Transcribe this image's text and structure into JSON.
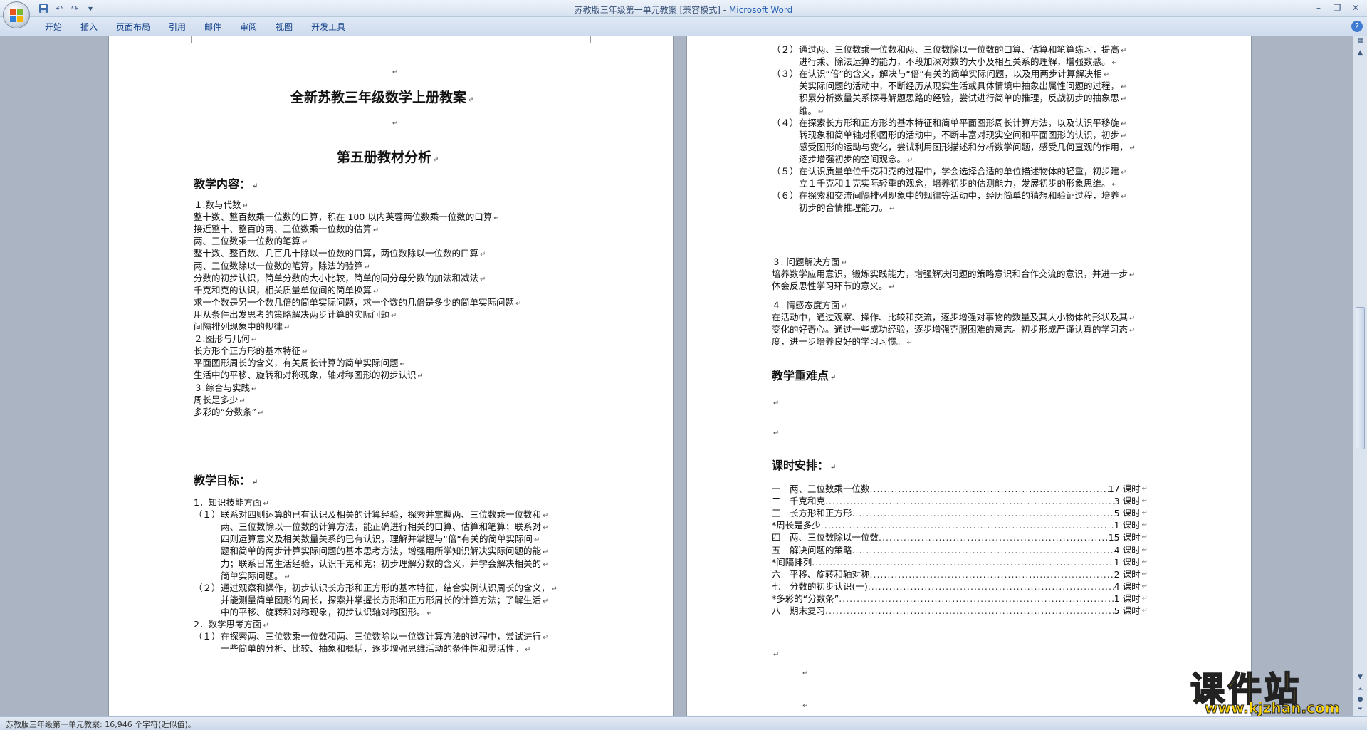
{
  "window": {
    "title": "苏教版三年级第一单元教案 [兼容模式] - ",
    "app_name": "Microsoft Word"
  },
  "tabs": [
    "开始",
    "插入",
    "页面布局",
    "引用",
    "邮件",
    "审阅",
    "视图",
    "开发工具"
  ],
  "status": {
    "text": "苏教版三年级第一单元教案: 16,946 个字符(近似值)。"
  },
  "watermark": {
    "title": "课件站",
    "url": "www.kjzhan.com"
  },
  "page1": {
    "doc_title": "全新苏教三年级数学上册教案",
    "subtitle": "第五册教材分析",
    "content_heading": "教学内容：",
    "content_lines": [
      "１.数与代数",
      "整十数、整百数乘一位数的口算，积在 100 以内芙蓉两位数乘一位数的口算",
      "接近整十、整百的两、三位数乘一位数的估算",
      "两、三位数乘一位数的笔算",
      "整十数、整百数、几百几十除以一位数的口算，两位数除以一位数的口算",
      "两、三位数除以一位数的笔算，除法的验算",
      "分数的初步认识，简单分数的大小比较，简单的同分母分数的加法和减法",
      "千克和克的认识，相关质量单位间的简单换算",
      "求一个数是另一个数几倍的简单实际问题，求一个数的几倍是多少的简单实际问题",
      "用从条件出发思考的策略解决两步计算的实际问题",
      "间隔排列现象中的规律",
      "２.图形与几何",
      "长方形个正方形的基本特征",
      "平面图形周长的含义，有关周长计算的简单实际问题",
      "生活中的平移、旋转和对称现象，轴对称图形的初步认识",
      "３.综合与实践",
      "周长是多少",
      "多彩的“分数条”"
    ],
    "goals_heading": "教学目标：",
    "goal_lines": [
      {
        "num": "",
        "text": "1．知识技能方面"
      },
      {
        "num": "（１）",
        "text": "联系对四则运算的已有认识及相关的计算经验，探索并掌握两、三位数乘一位数和"
      },
      {
        "num": "",
        "text": "两、三位数除以一位数的计算方法，能正确进行相关的口算、估算和笔算；联系对"
      },
      {
        "num": "",
        "text": "四则运算意义及相关数量关系的已有认识，理解并掌握与“倍“有关的简单实际问"
      },
      {
        "num": "",
        "text": "题和简单的两步计算实际问题的基本思考方法，增强用所学知识解决实际问题的能"
      },
      {
        "num": "",
        "text": "力；联系日常生活经验，认识千克和克；初步理解分数的含义，并学会解决相关的"
      },
      {
        "num": "",
        "text": "简单实际问题。"
      },
      {
        "num": "（２）",
        "text": "通过观察和操作，初步认识长方形和正方形的基本特征，结合实例认识周长的含义，"
      },
      {
        "num": "",
        "text": "并能测量简单图形的周长，探索并掌握长方形和正方形周长的计算方法；了解生活"
      },
      {
        "num": "",
        "text": "中的平移、旋转和对称现象，初步认识轴对称图形。"
      },
      {
        "num": "",
        "text": "2．数学思考方面"
      },
      {
        "num": "（１）",
        "text": "在探索两、三位数乘一位数和两、三位数除以一位数计算方法的过程中，尝试进行"
      },
      {
        "num": "",
        "text": "一些简单的分析、比较、抽象和概括，逐步增强思维活动的条件性和灵活性。"
      }
    ]
  },
  "page2": {
    "lines": [
      {
        "num": "（２）",
        "text": "通过两、三位数乘一位数和两、三位数除以一位数的口算、估算和笔算练习，提高"
      },
      {
        "num": "",
        "text": "进行乘、除法运算的能力，不段加深对数的大小及相互关系的理解，增强数感。"
      },
      {
        "num": "（３）",
        "text": "在认识“倍”的含义，解决与“倍”有关的简单实际问题，以及用两步计算解决相"
      },
      {
        "num": "",
        "text": "关实际问题的活动中，不断经历从现实生活或具体情境中抽象出属性问题的过程，"
      },
      {
        "num": "",
        "text": "积累分析数量关系探寻解题思路的经验，尝试进行简单的推理，反战初步的抽象思"
      },
      {
        "num": "",
        "text": "维。"
      },
      {
        "num": "（４）",
        "text": "在探索长方形和正方形的基本特征和简单平面图形周长计算方法，以及认识平移旋"
      },
      {
        "num": "",
        "text": "转现象和简单轴对称图形的活动中，不断丰富对现实空间和平面图形的认识，初步"
      },
      {
        "num": "",
        "text": "感受图形的运动与变化，尝试利用图形描述和分析数学问题，感受几何直观的作用，"
      },
      {
        "num": "",
        "text": "逐步增强初步的空间观念。"
      },
      {
        "num": "（５）",
        "text": "在认识质量单位千克和克的过程中，学会选择合适的单位描述物体的轻重，初步建"
      },
      {
        "num": "",
        "text": "立１千克和１克实际轻重的观念，培养初步的估测能力，发展初步的形象思维。"
      },
      {
        "num": "（６）",
        "text": "在探索和交流间隔排列现象中的规律等活动中，经历简单的猜想和验证过程，培养"
      },
      {
        "num": "",
        "text": "初步的合情推理能力。"
      }
    ],
    "problem_heading": "３. 问题解决方面",
    "problem_lines": [
      "培养数学应用意识，锻炼实践能力，增强解决问题的策略意识和合作交流的意识，并进一步",
      "体会反思性学习环节的意义。"
    ],
    "attitude_heading": "４. 情感态度方面",
    "attitude_lines": [
      "在活动中，通过观察、操作、比较和交流，逐步增强对事物的数量及其大小物体的形状及其",
      "变化的好奇心。通过一些成功经验，逐步增强克服困难的意志。初步形成严谨认真的学习态",
      "度，进一步培养良好的学习习惯。"
    ],
    "key_heading": "教学重难点",
    "schedule_heading": "课时安排：",
    "schedule": [
      {
        "label": "一　两、三位数乘一位数",
        "hours": "17 课时"
      },
      {
        "label": "二　千克和克",
        "hours": "3 课时"
      },
      {
        "label": "三　长方形和正方形",
        "hours": "5 课时"
      },
      {
        "label": "*周长是多少",
        "hours": "1 课时"
      },
      {
        "label": "四　两、三位数除以一位数",
        "hours": "15 课时"
      },
      {
        "label": "五　解决问题的策略",
        "hours": "4 课时"
      },
      {
        "label": "*间隔排列",
        "hours": "1 课时"
      },
      {
        "label": "六　平移、旋转和轴对称",
        "hours": "2 课时"
      },
      {
        "label": "七　分数的初步认识(一)",
        "hours": "4 课时"
      },
      {
        "label": "*多彩的“分数条”",
        "hours": "1 课时"
      },
      {
        "label": "八　期末复习",
        "hours": "5 课时"
      }
    ]
  }
}
